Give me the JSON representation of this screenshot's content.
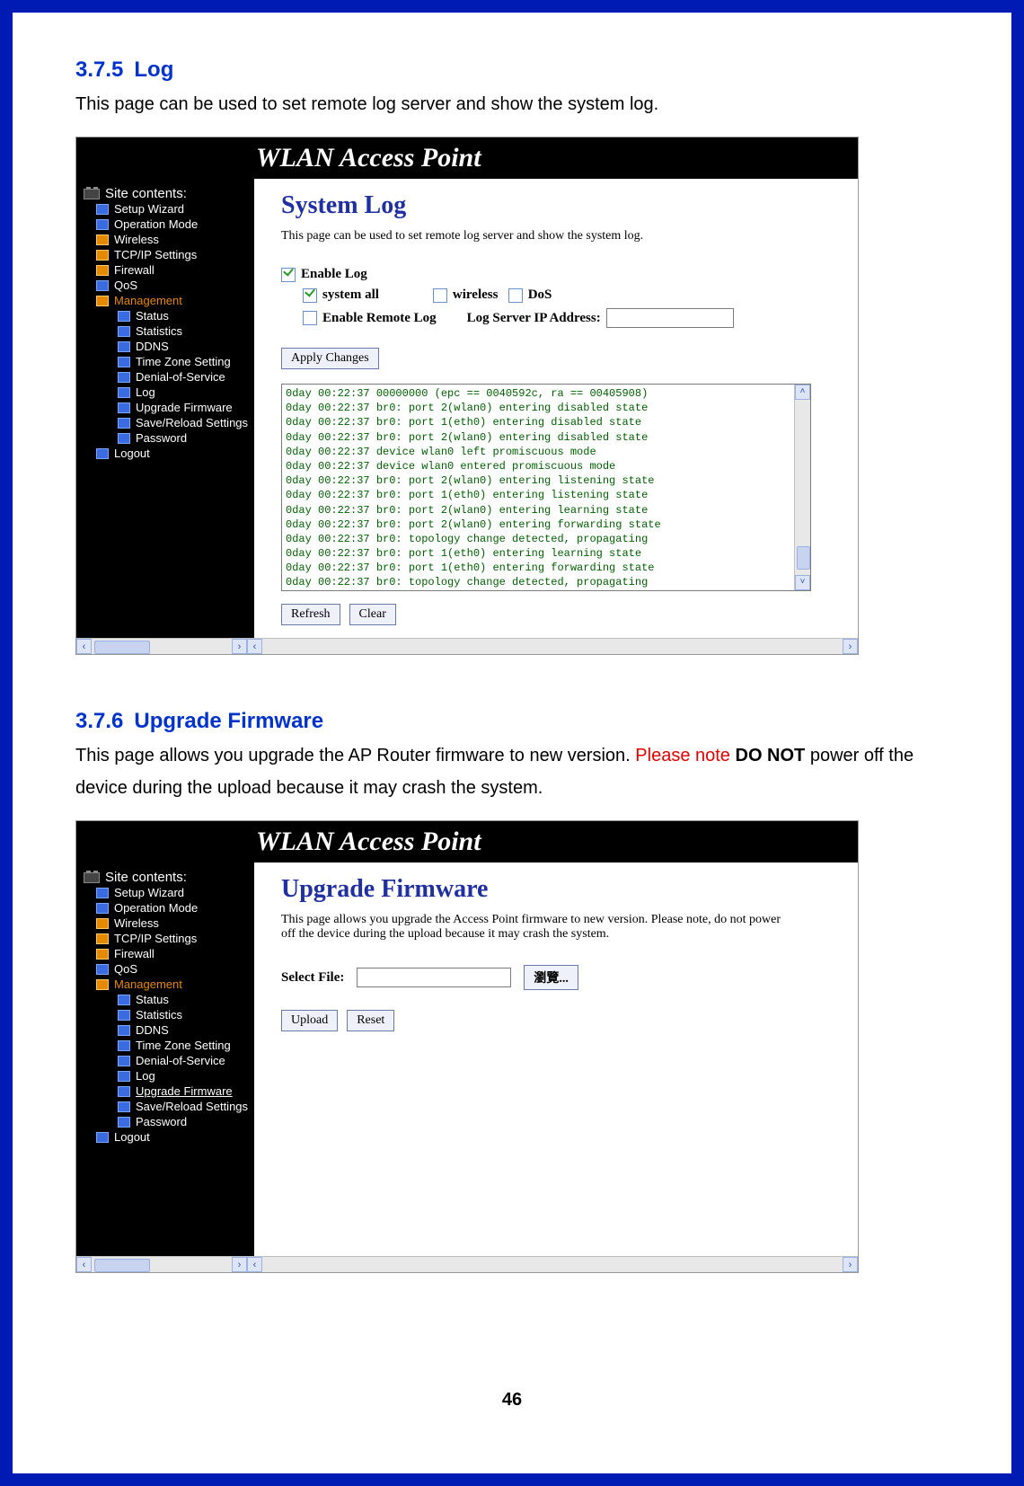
{
  "page_number": "46",
  "banner": "WLAN Access Point",
  "section1": {
    "number": "3.7.5",
    "title": "Log",
    "text": "This page can be used to set remote log server and show the system log."
  },
  "screenshot1": {
    "page_title": "System Log",
    "page_desc": "This page can be used to set remote log server and show the system log.",
    "enable_log": "Enable Log",
    "system_all": "system all",
    "wireless": "wireless",
    "dos": "DoS",
    "enable_remote": "Enable Remote Log",
    "log_server_label": "Log Server IP Address:",
    "btn_apply": "Apply Changes",
    "btn_refresh": "Refresh",
    "btn_clear": "Clear",
    "log_lines": "0day 00:22:37 00000000 (epc == 0040592c, ra == 00405908)\n0day 00:22:37 br0: port 2(wlan0) entering disabled state\n0day 00:22:37 br0: port 1(eth0) entering disabled state\n0day 00:22:37 br0: port 2(wlan0) entering disabled state\n0day 00:22:37 device wlan0 left promiscuous mode\n0day 00:22:37 device wlan0 entered promiscuous mode\n0day 00:22:37 br0: port 2(wlan0) entering listening state\n0day 00:22:37 br0: port 1(eth0) entering listening state\n0day 00:22:37 br0: port 2(wlan0) entering learning state\n0day 00:22:37 br0: port 2(wlan0) entering forwarding state\n0day 00:22:37 br0: topology change detected, propagating\n0day 00:22:37 br0: port 1(eth0) entering learning state\n0day 00:22:37 br0: port 1(eth0) entering forwarding state\n0day 00:22:37 br0: topology change detected, propagating"
  },
  "sidebar": {
    "root": "Site contents:",
    "items": [
      "Setup Wizard",
      "Operation Mode",
      "Wireless",
      "TCP/IP Settings",
      "Firewall",
      "QoS"
    ],
    "mgmt": "Management",
    "subitems": [
      "Status",
      "Statistics",
      "DDNS",
      "Time Zone Setting",
      "Denial-of-Service",
      "Log",
      "Upgrade Firmware",
      "Save/Reload Settings",
      "Password"
    ],
    "logout": "Logout"
  },
  "section2": {
    "number": "3.7.6",
    "title": "Upgrade Firmware",
    "text_before": "This page allows you upgrade the AP Router firmware to new version. ",
    "warn": "Please note ",
    "donot": "DO NOT",
    "text_after": " power off the device during the upload because it may crash the system."
  },
  "screenshot2": {
    "page_title": "Upgrade Firmware",
    "page_desc": "This page allows you upgrade the Access Point firmware to new version. Please note, do not power off the device during the upload because it may crash the system.",
    "select_file": "Select File:",
    "browse": "瀏覽...",
    "btn_upload": "Upload",
    "btn_reset": "Reset"
  }
}
